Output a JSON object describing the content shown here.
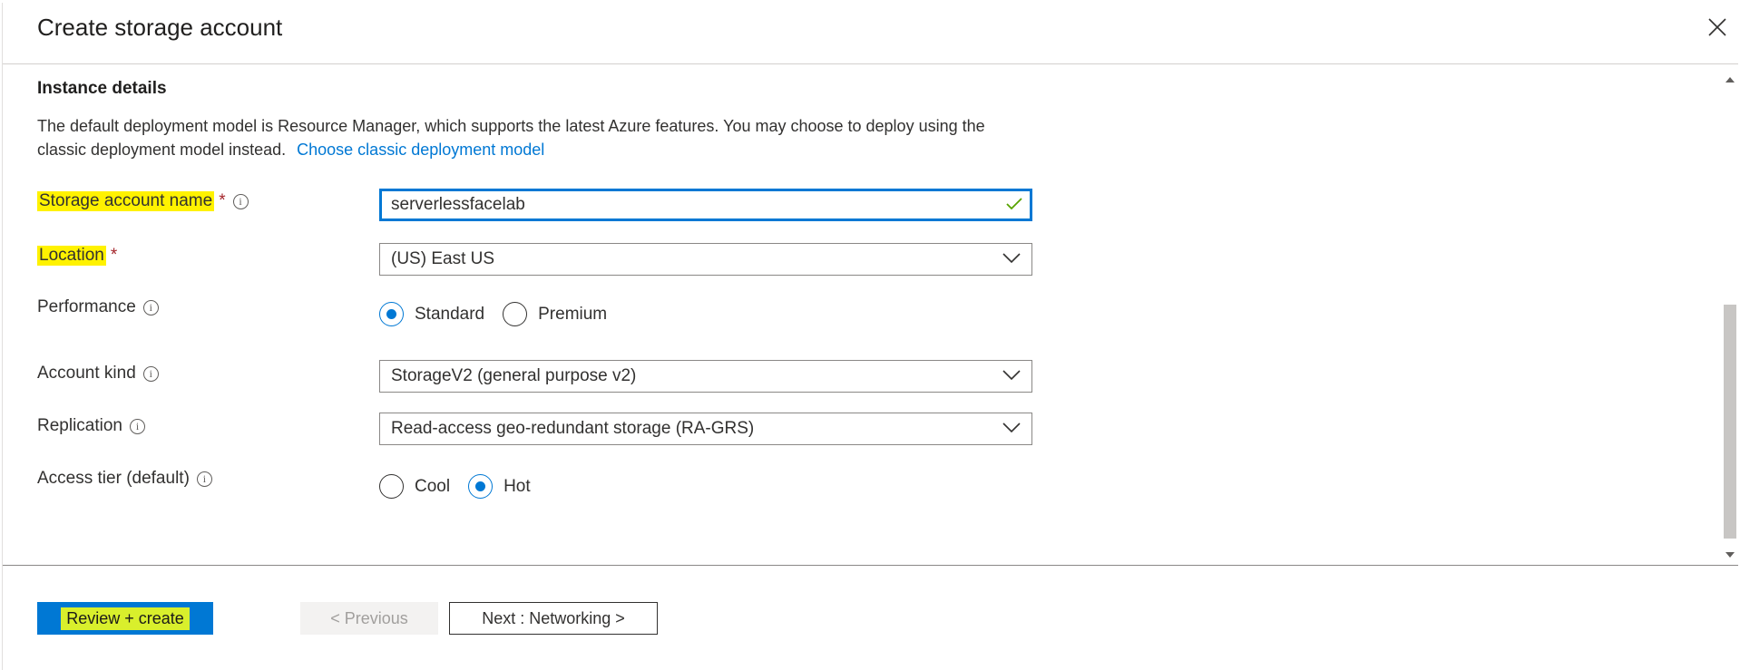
{
  "header": {
    "title": "Create storage account"
  },
  "section": {
    "title": "Instance details",
    "description": "The default deployment model is Resource Manager, which supports the latest Azure features. You may choose to deploy using the classic deployment model instead.",
    "link": "Choose classic deployment model"
  },
  "fields": {
    "storage_name": {
      "label": "Storage account name",
      "required": "*",
      "value": "serverlessfacelab"
    },
    "location": {
      "label": "Location",
      "required": "*",
      "value": "(US) East US"
    },
    "performance": {
      "label": "Performance",
      "options": [
        "Standard",
        "Premium"
      ],
      "selected": "Standard"
    },
    "account_kind": {
      "label": "Account kind",
      "value": "StorageV2 (general purpose v2)"
    },
    "replication": {
      "label": "Replication",
      "value": "Read-access geo-redundant storage (RA-GRS)"
    },
    "access_tier": {
      "label": "Access tier (default)",
      "options": [
        "Cool",
        "Hot"
      ],
      "selected": "Hot"
    }
  },
  "info_glyph": "i",
  "footer": {
    "review_create": "Review + create",
    "previous": "< Previous",
    "next": "Next : Networking >"
  },
  "colors": {
    "accent": "#0078d4",
    "highlight": "#fff200",
    "required": "#a4262c",
    "valid": "#57a300"
  },
  "icons": [
    "close-icon",
    "info-icon",
    "checkmark-icon",
    "chevron-down-icon",
    "scroll-up-icon",
    "scroll-down-icon"
  ]
}
